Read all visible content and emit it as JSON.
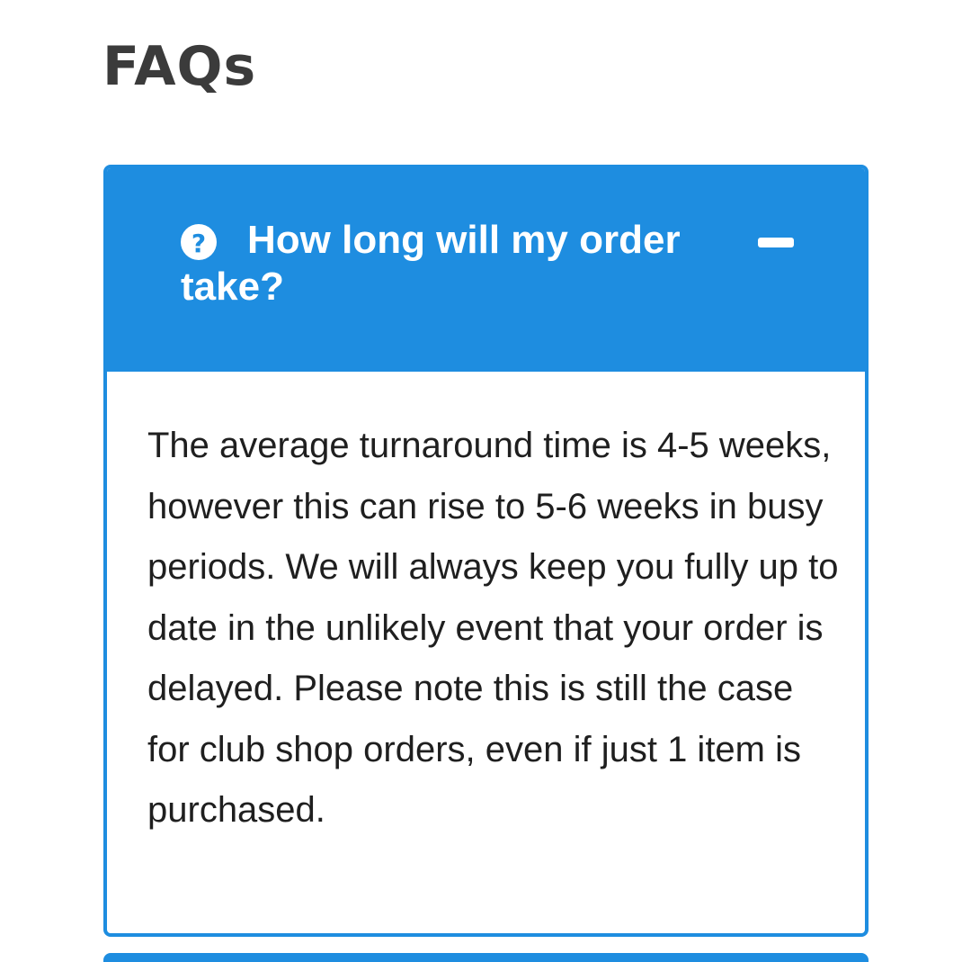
{
  "page": {
    "title": "FAQs"
  },
  "faq": {
    "items": [
      {
        "question": "How long will my order take?",
        "answer": "The average turnaround time is 4-5 weeks, however this can rise to 5-6 weeks in busy periods. We will always keep you fully up to date in the unlikely event that your order is delayed. Please note this is still the case for club shop orders, even if just 1 item is purchased.",
        "expanded": true,
        "icon": "question-circle-icon",
        "toggle_icon": "minus-icon"
      }
    ]
  },
  "colors": {
    "accent": "#1e8de0",
    "title_text": "#3b3b3b",
    "body_text": "#1f1f1f",
    "header_text": "#ffffff"
  }
}
